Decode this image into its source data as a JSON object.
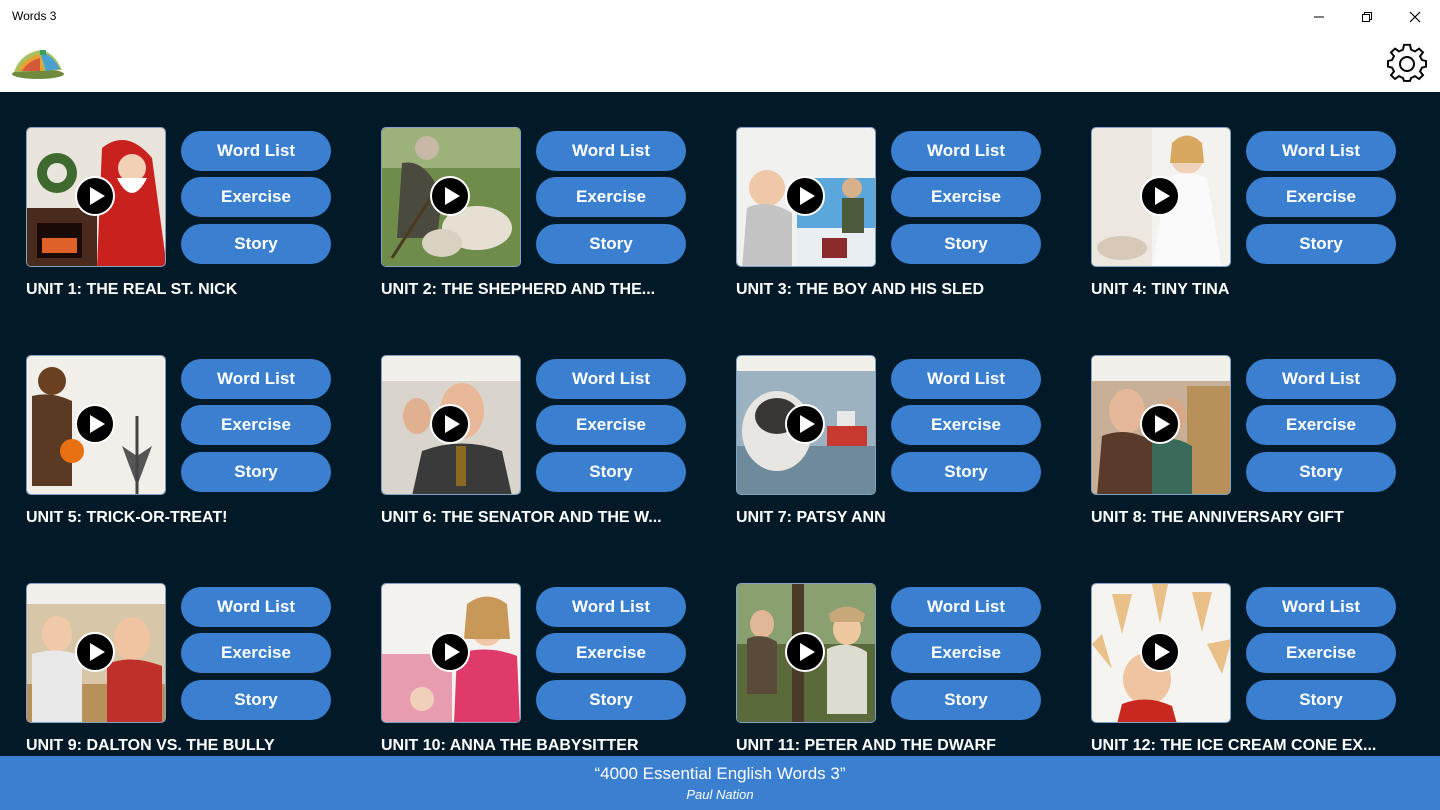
{
  "window": {
    "title": "Words 3"
  },
  "icons": {
    "logo": "book-stack-logo",
    "settings": "gear-icon",
    "play": "play-icon",
    "minimize": "minimize-icon",
    "maximize": "restore-icon",
    "close": "close-icon"
  },
  "colors": {
    "main_bg": "#021a27",
    "button_bg": "#3a7fd0",
    "footer_bg": "#3a7fd0"
  },
  "units": [
    {
      "title": "UNIT 1: THE REAL ST. NICK",
      "word_list": "Word List",
      "exercise": "Exercise",
      "story": "Story"
    },
    {
      "title": "UNIT 2: THE SHEPHERD AND THE...",
      "word_list": "Word List",
      "exercise": "Exercise",
      "story": "Story"
    },
    {
      "title": "UNIT 3: THE BOY AND HIS SLED",
      "word_list": "Word List",
      "exercise": "Exercise",
      "story": "Story"
    },
    {
      "title": "UNIT 4: TINY TINA",
      "word_list": "Word List",
      "exercise": "Exercise",
      "story": "Story"
    },
    {
      "title": "UNIT 5: TRICK-OR-TREAT!",
      "word_list": "Word List",
      "exercise": "Exercise",
      "story": "Story"
    },
    {
      "title": "UNIT 6: THE SENATOR AND THE W...",
      "word_list": "Word List",
      "exercise": "Exercise",
      "story": "Story"
    },
    {
      "title": "UNIT 7: PATSY ANN",
      "word_list": "Word List",
      "exercise": "Exercise",
      "story": "Story"
    },
    {
      "title": "UNIT 8: THE ANNIVERSARY GIFT",
      "word_list": "Word List",
      "exercise": "Exercise",
      "story": "Story"
    },
    {
      "title": "UNIT 9: DALTON VS. THE BULLY",
      "word_list": "Word List",
      "exercise": "Exercise",
      "story": "Story"
    },
    {
      "title": "UNIT 10: ANNA THE BABYSITTER",
      "word_list": "Word List",
      "exercise": "Exercise",
      "story": "Story"
    },
    {
      "title": "UNIT 11: PETER AND THE DWARF",
      "word_list": "Word List",
      "exercise": "Exercise",
      "story": "Story"
    },
    {
      "title": "UNIT 12: THE ICE CREAM CONE EX...",
      "word_list": "Word List",
      "exercise": "Exercise",
      "story": "Story"
    }
  ],
  "footer": {
    "book_title": "“4000 Essential English Words 3”",
    "author": "Paul Nation"
  }
}
